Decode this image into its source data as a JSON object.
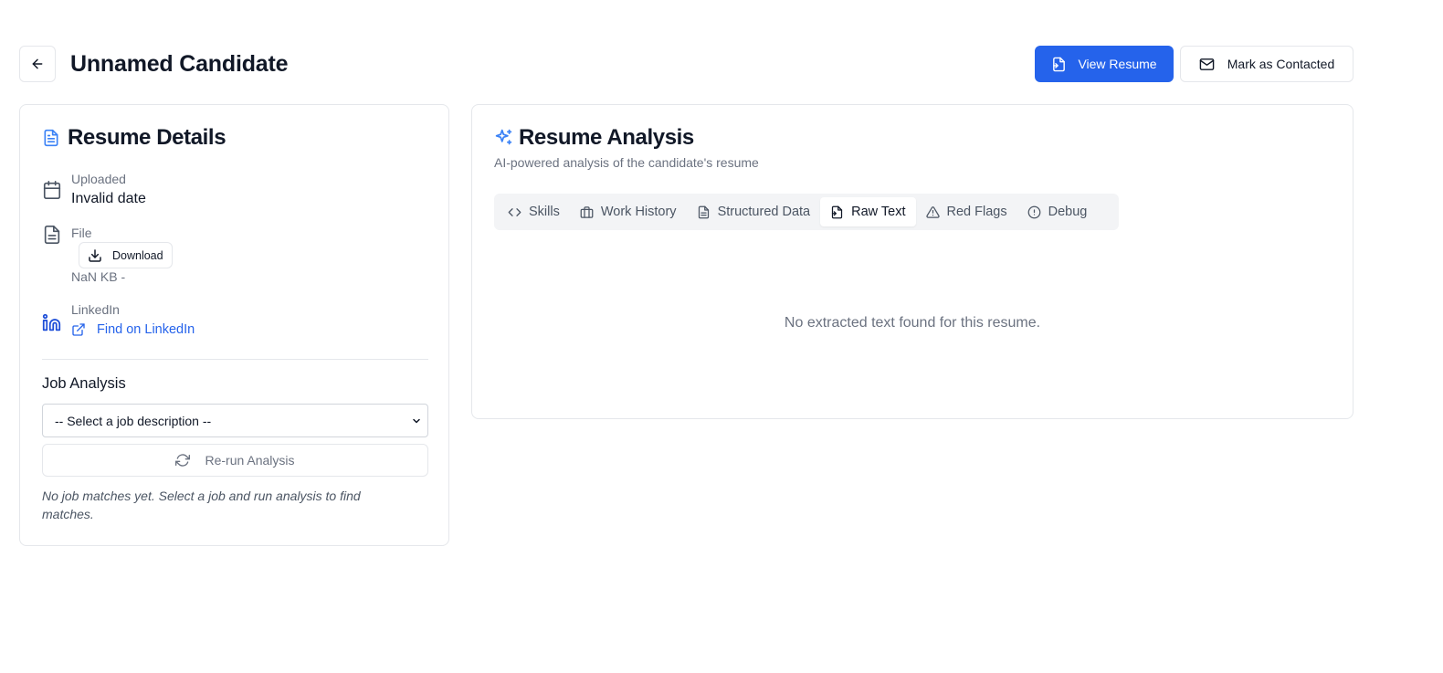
{
  "header": {
    "title": "Unnamed Candidate",
    "view_resume_label": "View Resume",
    "mark_contacted_label": "Mark as Contacted"
  },
  "resume_details": {
    "title": "Resume Details",
    "uploaded_label": "Uploaded",
    "uploaded_value": "Invalid date",
    "file_label": "File",
    "download_label": "Download",
    "file_meta": "NaN KB -",
    "linkedin_label": "LinkedIn",
    "linkedin_link": "Find on LinkedIn",
    "job_analysis_title": "Job Analysis",
    "job_select_value": "-- Select a job description --",
    "rerun_label": "Re-run Analysis",
    "no_matches_text": "No job matches yet. Select a job and run analysis to find matches."
  },
  "resume_analysis": {
    "title": "Resume Analysis",
    "subtitle": "AI-powered analysis of the candidate's resume",
    "tabs": [
      {
        "label": "Skills",
        "icon": "code-icon"
      },
      {
        "label": "Work History",
        "icon": "briefcase-icon"
      },
      {
        "label": "Structured Data",
        "icon": "file-text-icon"
      },
      {
        "label": "Raw Text",
        "icon": "file-icon"
      },
      {
        "label": "Red Flags",
        "icon": "alert-triangle-icon"
      },
      {
        "label": "Debug",
        "icon": "alert-circle-icon"
      }
    ],
    "active_tab": "Raw Text",
    "empty_message": "No extracted text found for this resume."
  },
  "colors": {
    "primary": "#2563eb",
    "accent_icon": "#3b82f6",
    "text": "#111827",
    "muted": "#6b7280",
    "border": "#e5e7eb"
  }
}
